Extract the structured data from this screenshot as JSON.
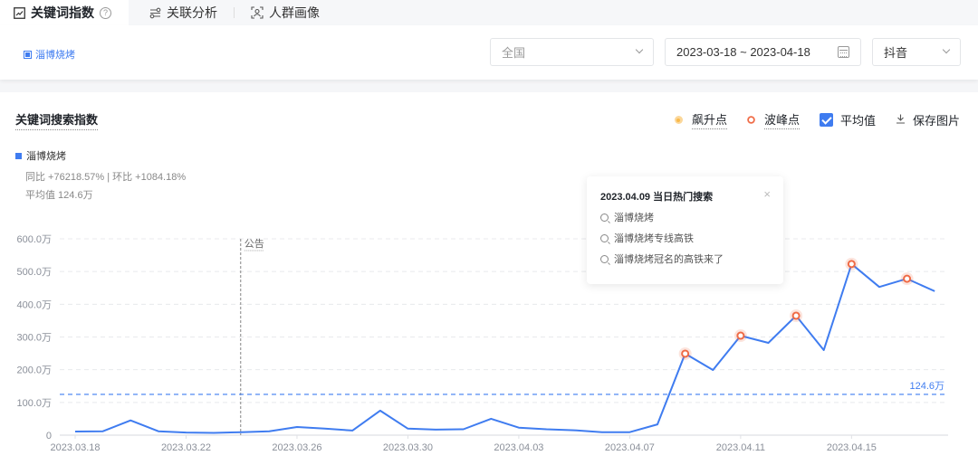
{
  "tabs": [
    {
      "label": "关键词指数",
      "icon": "trend-chart-icon",
      "active": true,
      "help": "?"
    },
    {
      "label": "关联分析",
      "icon": "relation-icon",
      "active": false
    },
    {
      "label": "人群画像",
      "icon": "user-portrait-icon",
      "active": false
    }
  ],
  "filters": {
    "keyword_chip": "淄博烧烤",
    "region": "全国",
    "date_range": "2023-03-18 ~ 2023-04-18",
    "platform": "抖音"
  },
  "chart_header": {
    "title": "关键词搜索指数",
    "legend_rise": "飙升点",
    "legend_peak": "波峰点",
    "avg_toggle": "平均值",
    "avg_checked": true,
    "save_label": "保存图片"
  },
  "series_info": {
    "name": "淄博烧烤",
    "yoy_mom": "同比 +76218.57% | 环比 +1084.18%",
    "avg": "平均值 124.6万"
  },
  "tooltip": {
    "title": "2023.04.09 当日热门搜索",
    "close": "×",
    "items": [
      "淄博烧烤",
      "淄博烧烤专线高铁",
      "淄博烧烤冠名的高铁来了"
    ]
  },
  "colors": {
    "line": "#3f7cf0",
    "avg_line": "#3f7cf0",
    "peak": "#ef6a45",
    "rise": "#f9b94a",
    "grid": "#e8e9ec",
    "annotation": "#999999"
  },
  "chart_data": {
    "type": "line",
    "title": "关键词搜索指数",
    "xlabel": "",
    "ylabel": "",
    "unit": "万",
    "ylim": [
      0,
      600
    ],
    "yticks": [
      0,
      100,
      200,
      300,
      400,
      500,
      600
    ],
    "ytick_labels": [
      "0",
      "100.0万",
      "200.0万",
      "300.0万",
      "400.0万",
      "500.0万",
      "600.0万"
    ],
    "grid": true,
    "x": [
      "2023.03.18",
      "2023.03.19",
      "2023.03.20",
      "2023.03.21",
      "2023.03.22",
      "2023.03.23",
      "2023.03.24",
      "2023.03.25",
      "2023.03.26",
      "2023.03.27",
      "2023.03.28",
      "2023.03.29",
      "2023.03.30",
      "2023.03.31",
      "2023.04.01",
      "2023.04.02",
      "2023.04.03",
      "2023.04.04",
      "2023.04.05",
      "2023.04.06",
      "2023.04.07",
      "2023.04.08",
      "2023.04.09",
      "2023.04.10",
      "2023.04.11",
      "2023.04.12",
      "2023.04.13",
      "2023.04.14",
      "2023.04.15",
      "2023.04.16",
      "2023.04.17",
      "2023.04.18"
    ],
    "xtick_labels": [
      "2023.03.18",
      "2023.03.22",
      "2023.03.26",
      "2023.03.30",
      "2023.04.03",
      "2023.04.07",
      "2023.04.11",
      "2023.04.15"
    ],
    "series": [
      {
        "name": "淄博烧烤",
        "values": [
          11,
          12,
          45,
          12,
          8,
          7,
          9,
          12,
          25,
          20,
          14,
          75,
          20,
          17,
          18,
          50,
          23,
          18,
          15,
          9,
          9,
          33,
          249,
          199,
          304,
          282,
          365,
          260,
          523,
          453,
          478,
          440
        ]
      }
    ],
    "peak_points": [
      "2023.04.09",
      "2023.04.11",
      "2023.04.13",
      "2023.04.15",
      "2023.04.17"
    ],
    "average": {
      "value": 124.6,
      "label": "124.6万"
    },
    "annotations": [
      {
        "x": "2023.03.24",
        "label": "公告"
      }
    ]
  }
}
